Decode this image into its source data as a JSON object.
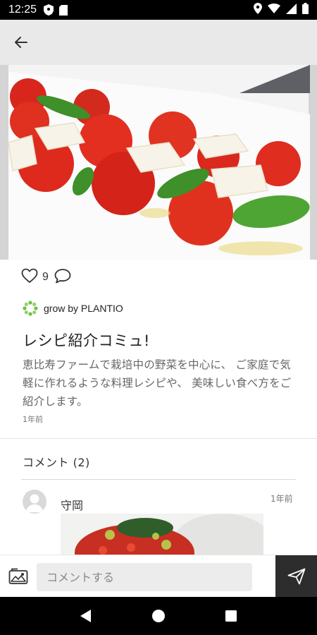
{
  "status_bar": {
    "time": "12:25",
    "icons": [
      "shield-icon",
      "sd-card-icon",
      "location-icon",
      "wifi-icon",
      "signal-icon",
      "battery-icon"
    ]
  },
  "app_bar": {
    "back_icon": "arrow-left-icon"
  },
  "post": {
    "like_count": "9",
    "author_name": "grow by PLANTIO",
    "title": "レシピ紹介コミュ!",
    "body": "恵比寿ファームで栽培中の野菜を中心に、 ご家庭で気軽に作れるような料理レシピや、 美味しい食べ方をご紹介します。",
    "posted_ago": "1年前"
  },
  "comments": {
    "header": "コメント (2)",
    "items": [
      {
        "author": "守岡",
        "posted_ago": "1年前"
      }
    ]
  },
  "composer": {
    "placeholder": "コメントする"
  },
  "colors": {
    "app_bar_bg": "#e9e9e9",
    "send_bg": "#2d2d2d",
    "brand_green": "#6cc04a"
  }
}
